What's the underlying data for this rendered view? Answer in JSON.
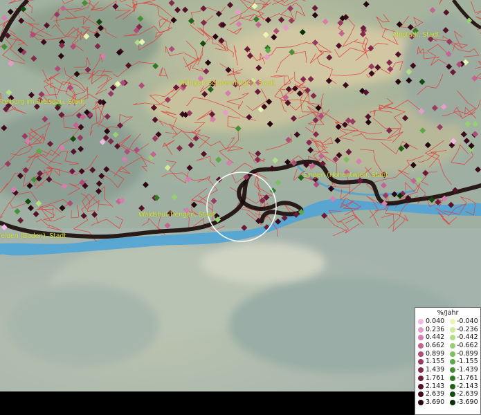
{
  "map": {
    "places": [
      {
        "id": "albstadt",
        "name": "Albstadt, Stadt"
      },
      {
        "id": "villingen",
        "name": "Villingen-Schwenningen, Stadt"
      },
      {
        "id": "freiburg",
        "name": "Freiburg im Breisgau, Stadt"
      },
      {
        "id": "singen",
        "name": "Singen (Hohentwiel), Stadt"
      },
      {
        "id": "waldshut",
        "name": "Waldshut-Tiengen, Stadt"
      },
      {
        "id": "rheinfelden",
        "name": "felden (Baden), Stadt"
      }
    ],
    "colors": {
      "border_line": "#1a0a0a",
      "district_line": "#e23b3b",
      "river": "#4aa3d8",
      "selection_circle": "#ffffff"
    }
  },
  "legend": {
    "title": "%/Jahr",
    "rows": [
      {
        "pos": "0.040",
        "pos_color": "#f3b9e6",
        "neg": "-0.040",
        "neg_color": "#e8f7b4"
      },
      {
        "pos": "0.236",
        "pos_color": "#e89ccc",
        "neg": "-0.236",
        "neg_color": "#cdeb9b"
      },
      {
        "pos": "0.442",
        "pos_color": "#d67eae",
        "neg": "-0.442",
        "neg_color": "#b2dd86"
      },
      {
        "pos": "0.662",
        "pos_color": "#c56393",
        "neg": "-0.662",
        "neg_color": "#97cf72"
      },
      {
        "pos": "0.899",
        "pos_color": "#b04c79",
        "neg": "-0.899",
        "neg_color": "#7cbf5f"
      },
      {
        "pos": "1.155",
        "pos_color": "#993a61",
        "neg": "-1.155",
        "neg_color": "#5ea848"
      },
      {
        "pos": "1.439",
        "pos_color": "#82294c",
        "neg": "-1.439",
        "neg_color": "#468f36"
      },
      {
        "pos": "1.761",
        "pos_color": "#6a1b39",
        "neg": "-1.761",
        "neg_color": "#327a27"
      },
      {
        "pos": "2.143",
        "pos_color": "#54112a",
        "neg": "-2.143",
        "neg_color": "#21621a"
      },
      {
        "pos": "2.639",
        "pos_color": "#3d0a1d",
        "neg": "-2.639",
        "neg_color": "#134a10"
      },
      {
        "pos": "3.690",
        "pos_color": "#260510",
        "neg": "-3.690",
        "neg_color": "#073207"
      }
    ]
  }
}
